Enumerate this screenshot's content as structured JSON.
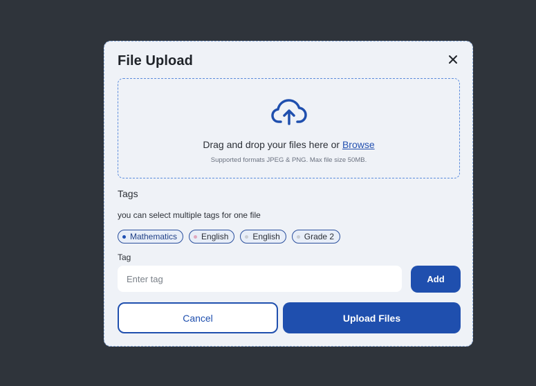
{
  "modal": {
    "title": "File Upload",
    "close_icon": "close-icon"
  },
  "dropzone": {
    "icon": "cloud-upload-icon",
    "text": "Drag and drop your files here or ",
    "browse_label": "Browse",
    "hint": "Supported formats JPEG & PNG. Max file size 50MB."
  },
  "tags": {
    "heading": "Tags",
    "subtext": "you can select multiple tags for one file",
    "chips": [
      {
        "label": "Mathematics",
        "selected": true,
        "dot_color": "#1e4fb3"
      },
      {
        "label": "English",
        "selected": false,
        "dot_color": "#e0a9bf"
      },
      {
        "label": "English",
        "selected": false,
        "dot_color": "#c9cdd4"
      },
      {
        "label": "Grade 2",
        "selected": false,
        "dot_color": "#c9cdd4"
      }
    ]
  },
  "tag_field": {
    "label": "Tag",
    "placeholder": "Enter tag",
    "value": "",
    "add_label": "Add"
  },
  "actions": {
    "cancel_label": "Cancel",
    "upload_label": "Upload Files"
  },
  "colors": {
    "primary": "#1f4fae",
    "backdrop": "#2f343b",
    "modal_bg": "#eff2f7"
  }
}
